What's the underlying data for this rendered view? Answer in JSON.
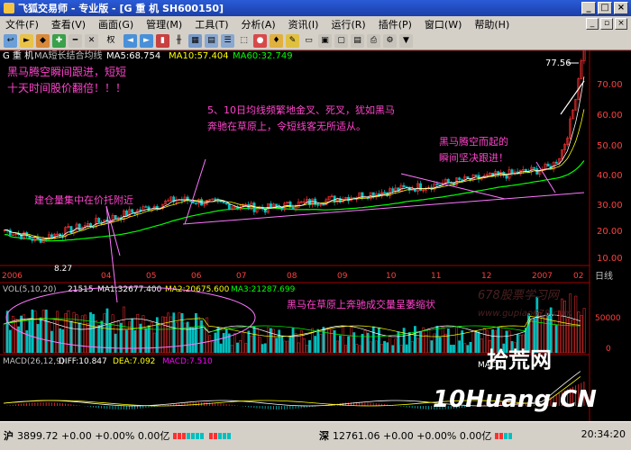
{
  "window": {
    "title": "飞狐交易师 - 专业版 - [G 重 机 SH600150]"
  },
  "menu": [
    "文件(F)",
    "查看(V)",
    "画面(G)",
    "管理(M)",
    "工具(T)",
    "分析(A)",
    "资讯(I)",
    "运行(R)",
    "插件(P)",
    "窗口(W)",
    "帮助(H)"
  ],
  "toolbar": {
    "rights_label": "权"
  },
  "main_header": {
    "stock": "G 重 机",
    "indicator": "MA短长结合均线",
    "ma5": "MA5:68.754",
    "ma10": "MA10:57.404",
    "ma60": "MA60:32.749"
  },
  "annotations": {
    "left_top_1": "黑马腾空瞬间跟进，短短",
    "left_top_2": "十天时间股价翻倍！！！",
    "mid_1": "5、10日均线频繁地金叉、死叉，犹如黑马",
    "mid_2": "奔驰在草原上，令短线客无所适从。",
    "right_1": "黑马腾空而起的",
    "right_2": "瞬间坚决跟进！",
    "build": "建仓量集中在价托附近",
    "volume_note": "黑马在草原上奔驰成交量呈萎缩状"
  },
  "price_axis": [
    "70.00",
    "60.00",
    "50.00",
    "40.00",
    "30.00",
    "20.00",
    "10.00",
    "日线"
  ],
  "high_label": "77.56",
  "low_label": "8.27",
  "time_axis": [
    "2006",
    "04",
    "05",
    "06",
    "07",
    "08",
    "09",
    "10",
    "11",
    "12",
    "2007",
    "02"
  ],
  "volume_header": {
    "label": "VOL(5,10,20)",
    "value": "21515",
    "ma1": "MA1:32677.400",
    "ma2": "MA2:20675.600",
    "ma3": "MA3:21287.699"
  },
  "volume_axis": [
    "50000",
    "0"
  ],
  "macd_header": {
    "label": "MACD(26,12,9)",
    "diff": "DIFF:10.847",
    "dea": "DEA:7.092",
    "macd": "MACD:7.510"
  },
  "macd_small_label": "MACD",
  "watermark1": "678股票学习网",
  "watermark2": "www.gupiao678.com",
  "watermark3": "拾荒网",
  "watermark4": "10Huang.CN",
  "status": {
    "sh_label": "沪",
    "sh_text": "3899.72 +0.00 +0.00% 0.00亿",
    "sz_label": "深",
    "sz_text": "12761.06 +0.00 +0.00% 0.00亿",
    "time": "20:34:20"
  },
  "colors": {
    "up": "#ff3030",
    "down": "#00c0c0",
    "ma5": "#ffffff",
    "ma10": "#ffff00",
    "ma60": "#00ff00",
    "annotation": "#ff44cc",
    "arrow": "#ff77ff"
  }
}
